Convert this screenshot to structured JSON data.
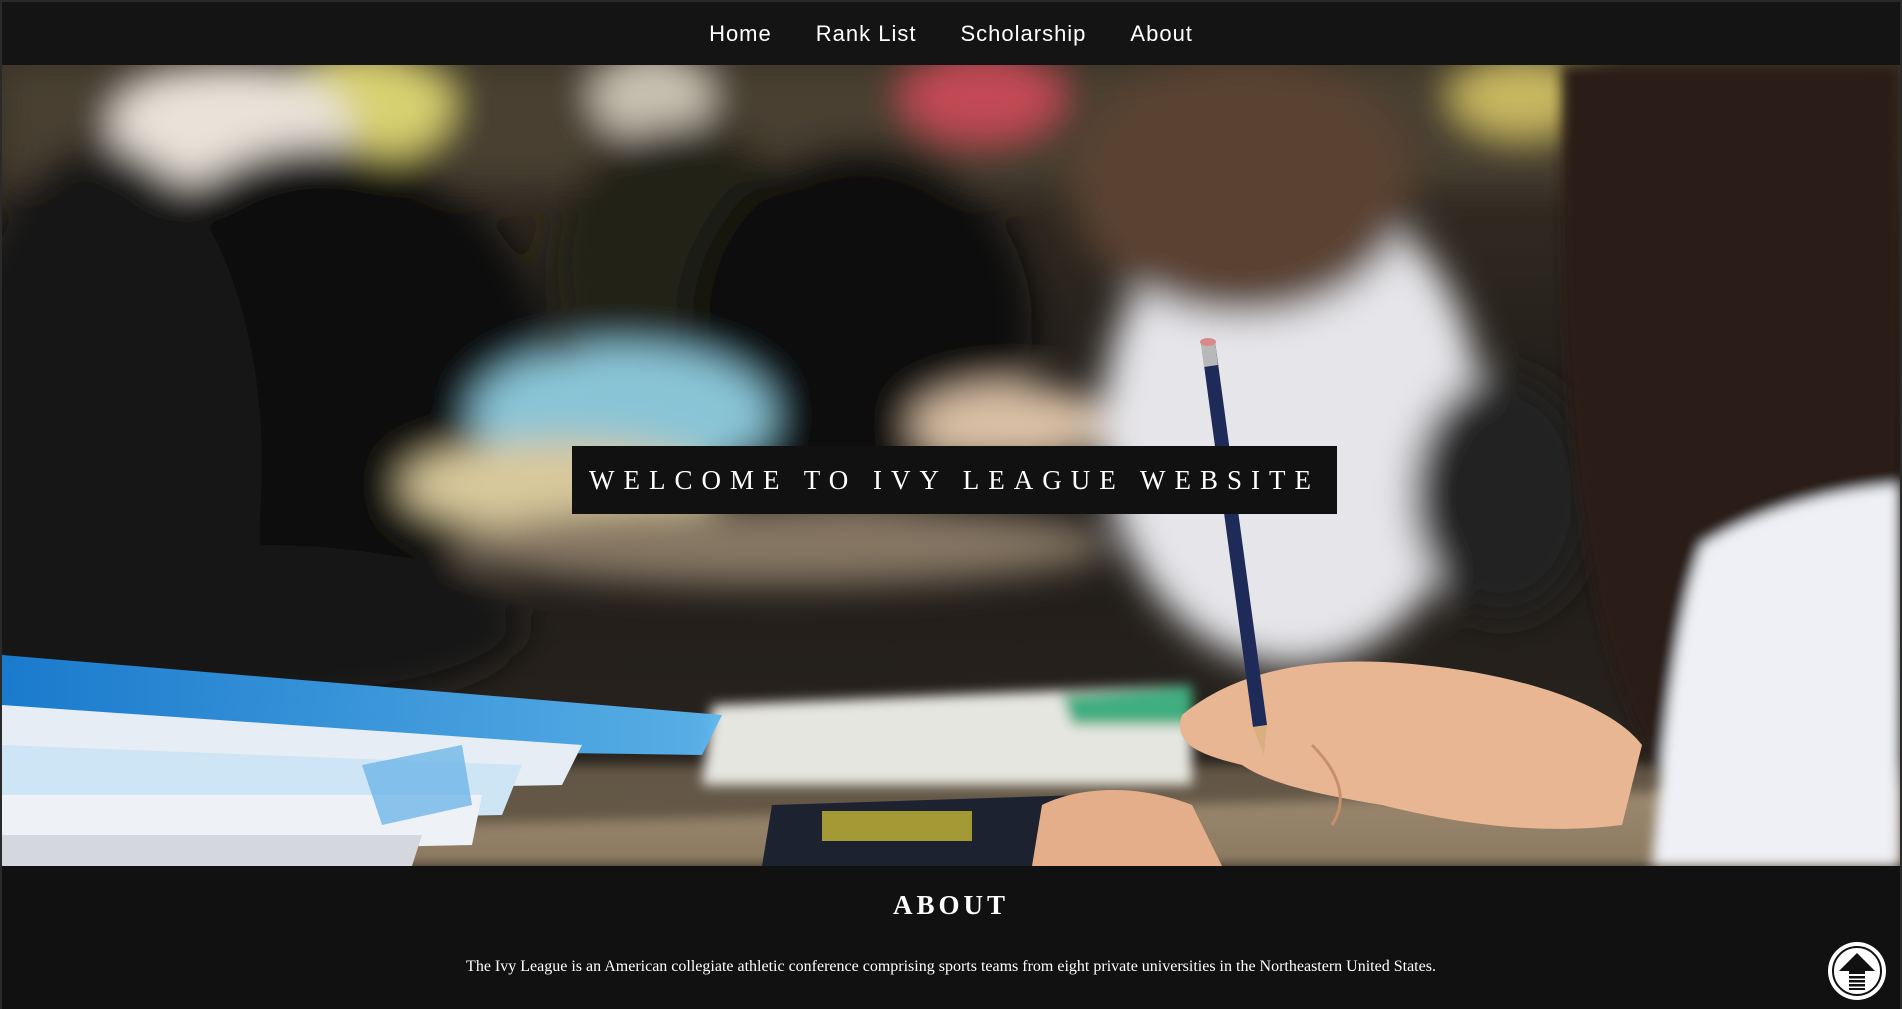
{
  "nav": {
    "items": [
      {
        "label": "Home"
      },
      {
        "label": "Rank List"
      },
      {
        "label": "Scholarship"
      },
      {
        "label": "About"
      }
    ]
  },
  "hero": {
    "title": "WELCOME TO IVY LEAGUE WEBSITE",
    "image": "classroom-students-writing-photo"
  },
  "about": {
    "heading": "ABOUT",
    "text": "The Ivy League is an American collegiate athletic conference comprising sports teams from eight private universities in the Northeastern United States."
  },
  "scroll_top": {
    "icon": "arrow-up-icon"
  }
}
